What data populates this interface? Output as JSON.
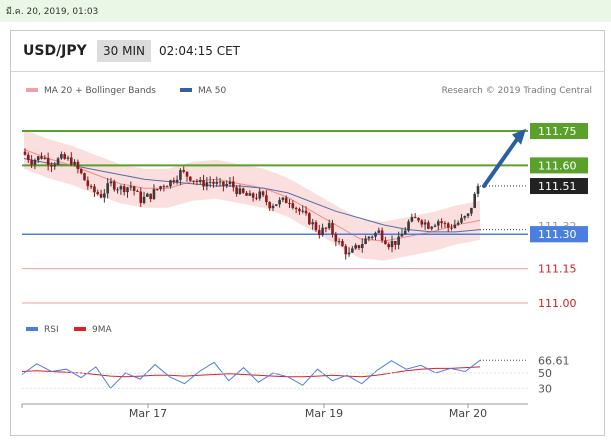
{
  "timestamp": "มี.ค. 20, 2019, 01:03",
  "header": {
    "pair": "USD/JPY",
    "timeframe": "30 MIN",
    "time": "02:04:15 CET"
  },
  "legend": {
    "ma20": "MA 20 + Bollinger Bands",
    "ma50": "MA 50",
    "credit": "Research © 2019 Trading Central"
  },
  "colors": {
    "resistance": "#5aa02c",
    "support": "#4a7fe0",
    "target": "#e05050",
    "arrow": "#2a5fa0",
    "candle_up": "#3a3a3a",
    "candle_down": "#8b1a1a",
    "bollinger": "#f9d0d0",
    "ma50": "#5570a8"
  },
  "chart_data": [
    {
      "type": "candlestick",
      "title": "USD/JPY 30 MIN",
      "x_tick_labels": [
        "Mar 17",
        "Mar 19",
        "Mar 20"
      ],
      "ylim": [
        110.98,
        111.78
      ],
      "levels": [
        {
          "label": "111.75",
          "value": 111.75,
          "kind": "resistance"
        },
        {
          "label": "111.60",
          "value": 111.6,
          "kind": "resistance"
        },
        {
          "label": "111.51",
          "value": 111.51,
          "kind": "current"
        },
        {
          "label": "111.30",
          "value": 111.3,
          "kind": "pivot"
        },
        {
          "label": "111.15",
          "value": 111.15,
          "kind": "support"
        },
        {
          "label": "111.00",
          "value": 111.0,
          "kind": "support"
        }
      ],
      "overlapped_label": "111.32",
      "price_path": [
        111.66,
        111.62,
        111.64,
        111.61,
        111.63,
        111.62,
        111.56,
        111.49,
        111.47,
        111.52,
        111.5,
        111.51,
        111.45,
        111.47,
        111.51,
        111.53,
        111.57,
        111.55,
        111.52,
        111.53,
        111.51,
        111.52,
        111.48,
        111.46,
        111.47,
        111.43,
        111.44,
        111.45,
        111.4,
        111.36,
        111.31,
        111.33,
        111.26,
        111.21,
        111.25,
        111.29,
        111.31,
        111.26,
        111.27,
        111.35,
        111.37,
        111.34,
        111.36,
        111.33,
        111.35,
        111.38,
        111.51
      ],
      "series": [
        {
          "name": "MA 20 + Bollinger Bands",
          "values": [
            111.67,
            111.63,
            111.6,
            111.56,
            111.52,
            111.5,
            111.5,
            111.53,
            111.54,
            111.52,
            111.5,
            111.46,
            111.4,
            111.34,
            111.28,
            111.27,
            111.29,
            111.31,
            111.34,
            111.36
          ]
        },
        {
          "name": "MA 50",
          "values": [
            111.63,
            111.61,
            111.6,
            111.58,
            111.56,
            111.54,
            111.53,
            111.52,
            111.51,
            111.51,
            111.5,
            111.48,
            111.44,
            111.4,
            111.37,
            111.34,
            111.32,
            111.31,
            111.31,
            111.32
          ]
        }
      ]
    },
    {
      "type": "line",
      "title": "RSI",
      "y_tick_labels": [
        "66.61",
        "50",
        "30"
      ],
      "ylim": [
        20,
        80
      ],
      "series": [
        {
          "name": "RSI",
          "values": [
            48,
            62,
            52,
            55,
            44,
            58,
            30,
            50,
            42,
            61,
            45,
            36,
            52,
            64,
            40,
            57,
            38,
            50,
            45,
            34,
            55,
            40,
            47,
            36,
            53,
            66,
            55,
            60,
            50,
            56,
            52,
            66.61
          ]
        },
        {
          "name": "9MA",
          "values": [
            52,
            53,
            52,
            51,
            50,
            48,
            46,
            45,
            46,
            47,
            47,
            46,
            47,
            48,
            49,
            48,
            47,
            46,
            45,
            45,
            46,
            47,
            46,
            45,
            47,
            50,
            53,
            55,
            56,
            56,
            57,
            58
          ]
        }
      ]
    }
  ]
}
